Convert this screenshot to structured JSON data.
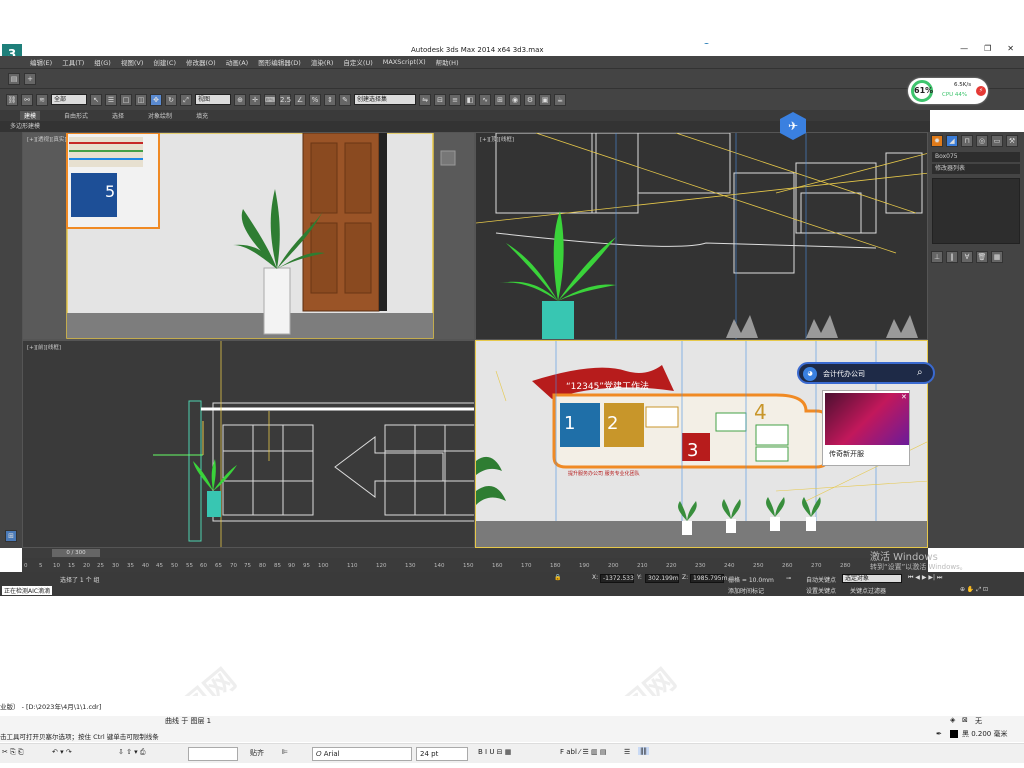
{
  "window": {
    "title": "Autodesk 3ds Max  2014 x64     3d3.max",
    "logo": "3",
    "controls": [
      "—",
      "❐",
      "✕"
    ]
  },
  "menu": [
    "编辑(E)",
    "工具(T)",
    "组(G)",
    "视图(V)",
    "创建(C)",
    "修改器(O)",
    "动画(A)",
    "图形编辑器(D)",
    "渲染(R)",
    "自定义(U)",
    "MAXScript(X)",
    "帮助(H)"
  ],
  "toolbar": {
    "selection_filter": "全部",
    "view_dropdown": "视图",
    "num_label": "2.5",
    "named_selection": "创建选择集"
  },
  "ribbon": {
    "tabs": [
      "建模",
      "自由形式",
      "选择",
      "对象绘制",
      "填充"
    ],
    "sub_label": "多边形建模"
  },
  "viewports": {
    "perspective_label": "[+][透视][真实]",
    "top_label": "[+][顶][线框]",
    "front_label": "[+][前][线框]",
    "camera_label": "",
    "poster_title": "“12345”党建工作法",
    "poster_footer": "提升服务办公司 服务专业化团队",
    "door_number": "5",
    "poster_numbers": [
      "1",
      "2",
      "3",
      "4"
    ]
  },
  "command_panel": {
    "object_name": "Box075",
    "modifier_list": "修改器列表"
  },
  "timeline": {
    "frame": "0 / 300",
    "ticks": [
      "0",
      "5",
      "10",
      "15",
      "20",
      "25",
      "30",
      "35",
      "40",
      "45",
      "50",
      "55",
      "60",
      "65",
      "70",
      "75",
      "80",
      "85",
      "90",
      "95",
      "100",
      "110",
      "120",
      "130",
      "140",
      "150",
      "160",
      "170",
      "180",
      "190",
      "200",
      "210",
      "220",
      "230",
      "240",
      "250",
      "260",
      "270",
      "280"
    ]
  },
  "status": {
    "selection": "选择了 1 个 组",
    "script_status": "正在检测AIC滴滴",
    "x": "-1372.533",
    "y": "302.199m",
    "z": "1985.795m",
    "grid": "栅格 = 10.0mm",
    "autokey": "自动关键点",
    "selection_set": "选定对象",
    "setkey": "设置关键点",
    "keyfilter": "关键点过滤器",
    "add_time": "添加时间标记"
  },
  "overlays": {
    "cpu_percent": "61%",
    "net_speed": "6.5K/s",
    "cpu_label": "CPU 44%",
    "search_text": "会计代办公司",
    "news_caption": "传奇新开服",
    "activate_title": "激活 Windows",
    "activate_sub": "转到“设置”以激活 Windows。"
  },
  "lower_app": {
    "title": "业版） - [D:\\2023年\\4月\\1\\1.cdr]",
    "layer_text": "曲线 于 图层 1",
    "hint": "击工具可打开贝塞尔选项；按住 Ctrl 键单击可限制线条",
    "fill_label": "无",
    "outline_label": "黑  0.200 毫米",
    "align_label": "贴齐",
    "font": "Arial",
    "font_size": "24 pt"
  },
  "watermark": "我图网"
}
